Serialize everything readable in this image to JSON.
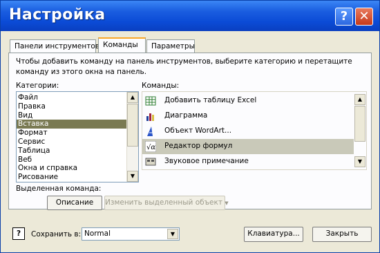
{
  "window": {
    "title": "Настройка",
    "help_label": "?",
    "close_label": "✕"
  },
  "tabs": [
    {
      "label": "Панели инструментов"
    },
    {
      "label": "Команды"
    },
    {
      "label": "Параметры"
    }
  ],
  "description": "Чтобы добавить команду на панель инструментов, выберите категорию и перетащите команду из этого окна на панель.",
  "categories": {
    "label": "Категории:",
    "items": [
      "Файл",
      "Правка",
      "Вид",
      "Вставка",
      "Формат",
      "Сервис",
      "Таблица",
      "Веб",
      "Окна и справка",
      "Рисование"
    ],
    "selected": "Вставка"
  },
  "commands": {
    "label": "Команды:",
    "items": [
      {
        "label": "Добавить таблицу Excel",
        "icon": "excel-table-icon"
      },
      {
        "label": "Диаграмма",
        "icon": "chart-icon"
      },
      {
        "label": "Объект WordArt...",
        "icon": "wordart-icon"
      },
      {
        "label": "Редактор формул",
        "icon": "equation-editor-icon"
      },
      {
        "label": "Звуковое примечание",
        "icon": "sound-note-icon"
      }
    ],
    "selected": "Редактор формул"
  },
  "selected_command": {
    "label": "Выделенная команда:",
    "describe_button": "Описание",
    "modify_button": "Изменить выделенный объект"
  },
  "footer": {
    "save_in_label": "Сохранить в:",
    "save_in_value": "Normal",
    "keyboard_button": "Клавиатура...",
    "close_button": "Закрыть"
  }
}
